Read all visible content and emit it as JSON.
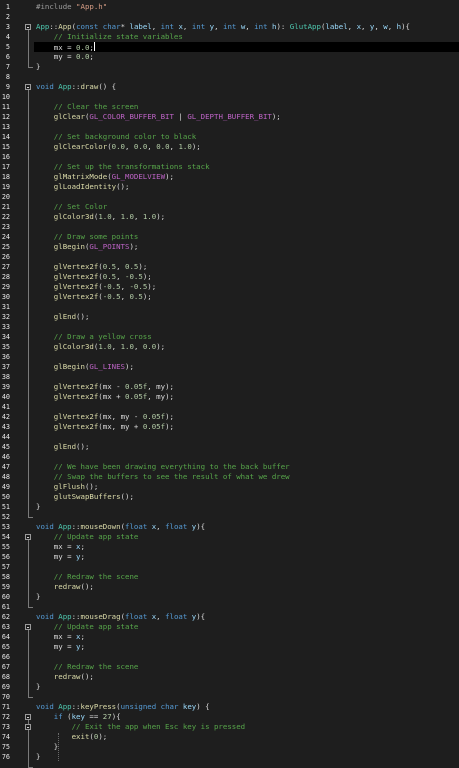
{
  "editor": {
    "language": "C++",
    "caret_line": 5,
    "lines": [
      [
        [
          "preproc",
          "#include "
        ],
        [
          "string",
          "\"App.h\""
        ]
      ],
      [],
      [
        [
          "type",
          "App"
        ],
        [
          "punct",
          "::"
        ],
        [
          "func",
          "App"
        ],
        [
          "punct",
          "("
        ],
        [
          "keyword",
          "const "
        ],
        [
          "keyword",
          "char"
        ],
        [
          "punct",
          "* "
        ],
        [
          "param",
          "label"
        ],
        [
          "punct",
          ", "
        ],
        [
          "keyword",
          "int "
        ],
        [
          "param",
          "x"
        ],
        [
          "punct",
          ", "
        ],
        [
          "keyword",
          "int "
        ],
        [
          "param",
          "y"
        ],
        [
          "punct",
          ", "
        ],
        [
          "keyword",
          "int "
        ],
        [
          "param",
          "w"
        ],
        [
          "punct",
          ", "
        ],
        [
          "keyword",
          "int "
        ],
        [
          "param",
          "h"
        ],
        [
          "punct",
          "): "
        ],
        [
          "type",
          "GlutApp"
        ],
        [
          "punct",
          "("
        ],
        [
          "param",
          "label"
        ],
        [
          "punct",
          ", "
        ],
        [
          "param",
          "x"
        ],
        [
          "punct",
          ", "
        ],
        [
          "param",
          "y"
        ],
        [
          "punct",
          ", "
        ],
        [
          "param",
          "w"
        ],
        [
          "punct",
          ", "
        ],
        [
          "param",
          "h"
        ],
        [
          "punct",
          "){"
        ]
      ],
      [
        [
          "comment",
          "    // Initialize state variables"
        ]
      ],
      [
        [
          "ident",
          "    mx = "
        ],
        [
          "number",
          "0.0"
        ],
        [
          "punct",
          ";"
        ]
      ],
      [
        [
          "ident",
          "    my = "
        ],
        [
          "number",
          "0.0"
        ],
        [
          "punct",
          ";"
        ]
      ],
      [
        [
          "punct",
          "}"
        ]
      ],
      [],
      [
        [
          "keyword",
          "void "
        ],
        [
          "type",
          "App"
        ],
        [
          "punct",
          "::"
        ],
        [
          "func",
          "draw"
        ],
        [
          "punct",
          "() {"
        ]
      ],
      [],
      [
        [
          "comment",
          "    // Clear the screen"
        ]
      ],
      [
        [
          "func",
          "    glClear"
        ],
        [
          "punct",
          "("
        ],
        [
          "macro",
          "GL_COLOR_BUFFER_BIT"
        ],
        [
          "punct",
          " | "
        ],
        [
          "macro",
          "GL_DEPTH_BUFFER_BIT"
        ],
        [
          "punct",
          ");"
        ]
      ],
      [],
      [
        [
          "comment",
          "    // Set background color to black"
        ]
      ],
      [
        [
          "func",
          "    glClearColor"
        ],
        [
          "punct",
          "("
        ],
        [
          "number",
          "0.0"
        ],
        [
          "punct",
          ", "
        ],
        [
          "number",
          "0.0"
        ],
        [
          "punct",
          ", "
        ],
        [
          "number",
          "0.0"
        ],
        [
          "punct",
          ", "
        ],
        [
          "number",
          "1.0"
        ],
        [
          "punct",
          ");"
        ]
      ],
      [],
      [
        [
          "comment",
          "    // Set up the transformations stack"
        ]
      ],
      [
        [
          "func",
          "    glMatrixMode"
        ],
        [
          "punct",
          "("
        ],
        [
          "macro",
          "GL_MODELVIEW"
        ],
        [
          "punct",
          ");"
        ]
      ],
      [
        [
          "func",
          "    glLoadIdentity"
        ],
        [
          "punct",
          "();"
        ]
      ],
      [],
      [
        [
          "comment",
          "    // Set Color"
        ]
      ],
      [
        [
          "func",
          "    glColor3d"
        ],
        [
          "punct",
          "("
        ],
        [
          "number",
          "1.0"
        ],
        [
          "punct",
          ", "
        ],
        [
          "number",
          "1.0"
        ],
        [
          "punct",
          ", "
        ],
        [
          "number",
          "1.0"
        ],
        [
          "punct",
          ");"
        ]
      ],
      [],
      [
        [
          "comment",
          "    // Draw some points"
        ]
      ],
      [
        [
          "func",
          "    glBegin"
        ],
        [
          "punct",
          "("
        ],
        [
          "macro",
          "GL_POINTS"
        ],
        [
          "punct",
          ");"
        ]
      ],
      [],
      [
        [
          "func",
          "    glVertex2f"
        ],
        [
          "punct",
          "("
        ],
        [
          "number",
          "0.5"
        ],
        [
          "punct",
          ", "
        ],
        [
          "number",
          "0.5"
        ],
        [
          "punct",
          ");"
        ]
      ],
      [
        [
          "func",
          "    glVertex2f"
        ],
        [
          "punct",
          "("
        ],
        [
          "number",
          "0.5"
        ],
        [
          "punct",
          ", "
        ],
        [
          "number",
          "-0.5"
        ],
        [
          "punct",
          ");"
        ]
      ],
      [
        [
          "func",
          "    glVertex2f"
        ],
        [
          "punct",
          "("
        ],
        [
          "number",
          "-0.5"
        ],
        [
          "punct",
          ", "
        ],
        [
          "number",
          "-0.5"
        ],
        [
          "punct",
          ");"
        ]
      ],
      [
        [
          "func",
          "    glVertex2f"
        ],
        [
          "punct",
          "("
        ],
        [
          "number",
          "-0.5"
        ],
        [
          "punct",
          ", "
        ],
        [
          "number",
          "0.5"
        ],
        [
          "punct",
          ");"
        ]
      ],
      [],
      [
        [
          "func",
          "    glEnd"
        ],
        [
          "punct",
          "();"
        ]
      ],
      [],
      [
        [
          "comment",
          "    // Draw a yellow cross"
        ]
      ],
      [
        [
          "func",
          "    glColor3d"
        ],
        [
          "punct",
          "("
        ],
        [
          "number",
          "1.0"
        ],
        [
          "punct",
          ", "
        ],
        [
          "number",
          "1.0"
        ],
        [
          "punct",
          ", "
        ],
        [
          "number",
          "0.0"
        ],
        [
          "punct",
          ");"
        ]
      ],
      [],
      [
        [
          "func",
          "    glBegin"
        ],
        [
          "punct",
          "("
        ],
        [
          "macro",
          "GL_LINES"
        ],
        [
          "punct",
          ");"
        ]
      ],
      [],
      [
        [
          "func",
          "    glVertex2f"
        ],
        [
          "punct",
          "("
        ],
        [
          "ident",
          "mx - "
        ],
        [
          "number",
          "0.05f"
        ],
        [
          "punct",
          ", "
        ],
        [
          "ident",
          "my"
        ],
        [
          "punct",
          ");"
        ]
      ],
      [
        [
          "func",
          "    glVertex2f"
        ],
        [
          "punct",
          "("
        ],
        [
          "ident",
          "mx + "
        ],
        [
          "number",
          "0.05f"
        ],
        [
          "punct",
          ", "
        ],
        [
          "ident",
          "my"
        ],
        [
          "punct",
          ");"
        ]
      ],
      [],
      [
        [
          "func",
          "    glVertex2f"
        ],
        [
          "punct",
          "("
        ],
        [
          "ident",
          "mx"
        ],
        [
          "punct",
          ", "
        ],
        [
          "ident",
          "my - "
        ],
        [
          "number",
          "0.05f"
        ],
        [
          "punct",
          ");"
        ]
      ],
      [
        [
          "func",
          "    glVertex2f"
        ],
        [
          "punct",
          "("
        ],
        [
          "ident",
          "mx"
        ],
        [
          "punct",
          ", "
        ],
        [
          "ident",
          "my + "
        ],
        [
          "number",
          "0.05f"
        ],
        [
          "punct",
          ");"
        ]
      ],
      [],
      [
        [
          "func",
          "    glEnd"
        ],
        [
          "punct",
          "();"
        ]
      ],
      [],
      [
        [
          "comment",
          "    // We have been drawing everything to the back buffer"
        ]
      ],
      [
        [
          "comment",
          "    // Swap the buffers to see the result of what we drew"
        ]
      ],
      [
        [
          "func",
          "    glFlush"
        ],
        [
          "punct",
          "();"
        ]
      ],
      [
        [
          "func",
          "    glutSwapBuffers"
        ],
        [
          "punct",
          "();"
        ]
      ],
      [
        [
          "punct",
          "}"
        ]
      ],
      [],
      [
        [
          "keyword",
          "void "
        ],
        [
          "type",
          "App"
        ],
        [
          "punct",
          "::"
        ],
        [
          "func",
          "mouseDown"
        ],
        [
          "punct",
          "("
        ],
        [
          "keyword",
          "float "
        ],
        [
          "param",
          "x"
        ],
        [
          "punct",
          ", "
        ],
        [
          "keyword",
          "float "
        ],
        [
          "param",
          "y"
        ],
        [
          "punct",
          "){"
        ]
      ],
      [
        [
          "comment",
          "    // Update app state"
        ]
      ],
      [
        [
          "ident",
          "    mx = "
        ],
        [
          "param",
          "x"
        ],
        [
          "punct",
          ";"
        ]
      ],
      [
        [
          "ident",
          "    my = "
        ],
        [
          "param",
          "y"
        ],
        [
          "punct",
          ";"
        ]
      ],
      [],
      [
        [
          "comment",
          "    // Redraw the scene"
        ]
      ],
      [
        [
          "func",
          "    redraw"
        ],
        [
          "punct",
          "();"
        ]
      ],
      [
        [
          "punct",
          "}"
        ]
      ],
      [],
      [
        [
          "keyword",
          "void "
        ],
        [
          "type",
          "App"
        ],
        [
          "punct",
          "::"
        ],
        [
          "func",
          "mouseDrag"
        ],
        [
          "punct",
          "("
        ],
        [
          "keyword",
          "float "
        ],
        [
          "param",
          "x"
        ],
        [
          "punct",
          ", "
        ],
        [
          "keyword",
          "float "
        ],
        [
          "param",
          "y"
        ],
        [
          "punct",
          "){"
        ]
      ],
      [
        [
          "comment",
          "    // Update app state"
        ]
      ],
      [
        [
          "ident",
          "    mx = "
        ],
        [
          "param",
          "x"
        ],
        [
          "punct",
          ";"
        ]
      ],
      [
        [
          "ident",
          "    my = "
        ],
        [
          "param",
          "y"
        ],
        [
          "punct",
          ";"
        ]
      ],
      [],
      [
        [
          "comment",
          "    // Redraw the scene"
        ]
      ],
      [
        [
          "func",
          "    redraw"
        ],
        [
          "punct",
          "();"
        ]
      ],
      [
        [
          "punct",
          "}"
        ]
      ],
      [],
      [
        [
          "keyword",
          "void "
        ],
        [
          "type",
          "App"
        ],
        [
          "punct",
          "::"
        ],
        [
          "func",
          "keyPress"
        ],
        [
          "punct",
          "("
        ],
        [
          "keyword",
          "unsigned "
        ],
        [
          "keyword",
          "char "
        ],
        [
          "param",
          "key"
        ],
        [
          "punct",
          ") {"
        ]
      ],
      [
        [
          "keyword",
          "    if "
        ],
        [
          "punct",
          "("
        ],
        [
          "param",
          "key"
        ],
        [
          "punct",
          " == "
        ],
        [
          "number",
          "27"
        ],
        [
          "punct",
          "){"
        ]
      ],
      [
        [
          "comment",
          "        // Exit the app when Esc key is pressed"
        ]
      ],
      [
        [
          "func",
          "        exit"
        ],
        [
          "punct",
          "("
        ],
        [
          "number",
          "0"
        ],
        [
          "punct",
          ");"
        ]
      ],
      [
        [
          "punct",
          "    }"
        ]
      ],
      [
        [
          "punct",
          "}"
        ]
      ]
    ]
  }
}
